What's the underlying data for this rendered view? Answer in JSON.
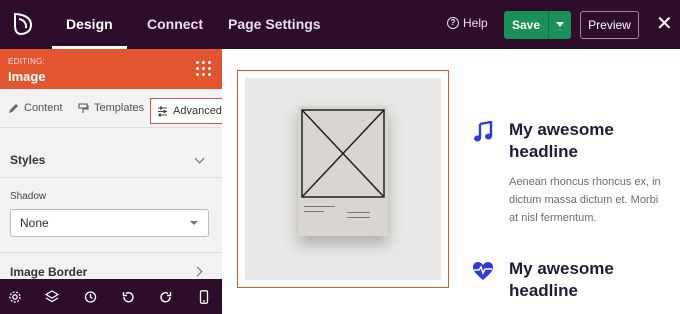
{
  "topbar": {
    "logo_icon": "seedprod-leaf-icon",
    "tabs": [
      {
        "label": "Design",
        "active": true
      },
      {
        "label": "Connect",
        "active": false
      },
      {
        "label": "Page Settings",
        "active": false
      }
    ],
    "help_label": "Help",
    "save_label": "Save",
    "preview_label": "Preview",
    "close_icon": "close-icon",
    "colors": {
      "bg": "#2d0d2b",
      "save": "#1a8f57"
    }
  },
  "sidebar": {
    "editing_label": "EDITING:",
    "editing_title": "Image",
    "accent": "#e2552e",
    "subtabs": [
      {
        "label": "Content",
        "icon": "pencil-icon",
        "active": false
      },
      {
        "label": "Templates",
        "icon": "paint-roller-icon",
        "active": false
      },
      {
        "label": "Advanced",
        "icon": "sliders-icon",
        "active": true
      }
    ],
    "styles_label": "Styles",
    "shadow_label": "Shadow",
    "shadow_value": "None",
    "image_border_label": "Image Border",
    "bottom_icons": [
      "gear-icon",
      "layers-icon",
      "history-icon",
      "undo-icon",
      "redo-icon",
      "mobile-preview-icon"
    ]
  },
  "canvas": {
    "features": [
      {
        "icon": "music-note-icon",
        "title": "My awesome headline",
        "body": "Aenean rhoncus rhoncus ex, in dictum massa dictum et. Morbi at nisl fermentum."
      },
      {
        "icon": "heartbeat-icon",
        "title": "My awesome headline"
      }
    ],
    "icon_color": "#2f3bd6"
  }
}
